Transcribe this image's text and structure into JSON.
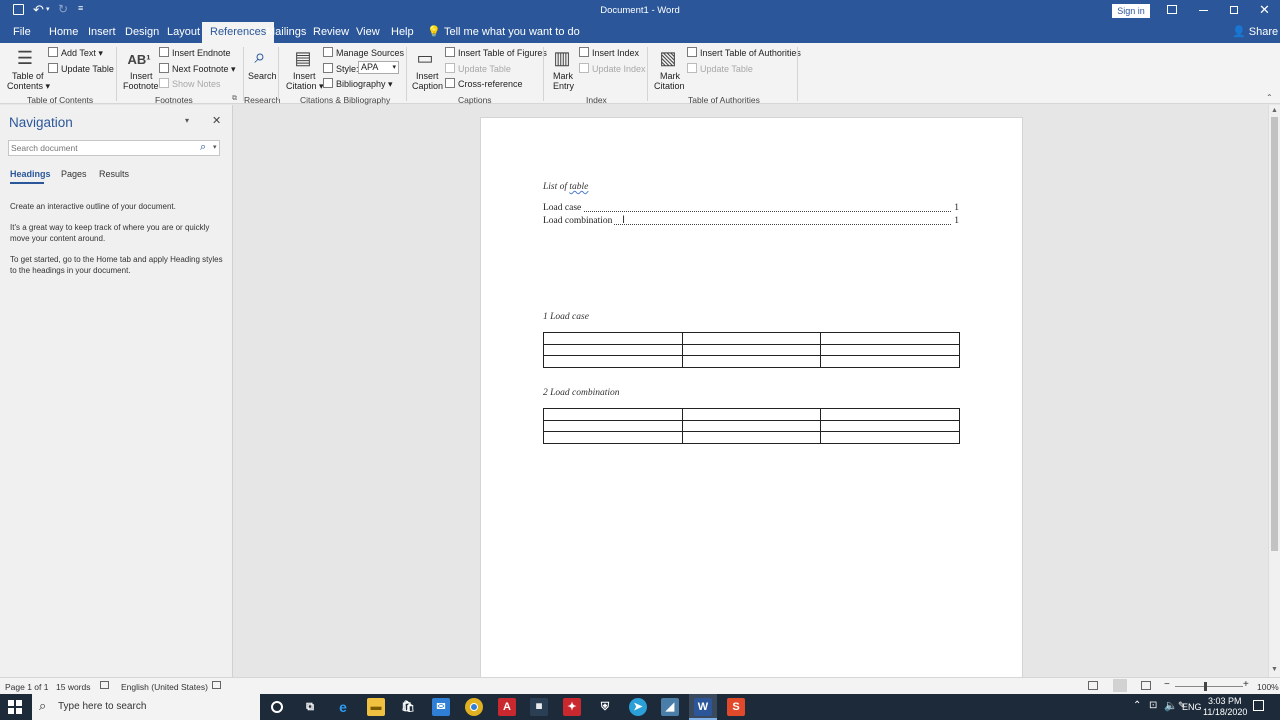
{
  "titlebar": {
    "title": "Document1  -  Word",
    "signin": "Sign in",
    "share": "Share"
  },
  "tabs": [
    "File",
    "Home",
    "Insert",
    "Design",
    "Layout",
    "References",
    "Mailings",
    "Review",
    "View",
    "Help"
  ],
  "tell_me": "Tell me what you want to do",
  "ribbon": {
    "toc": {
      "big": "Table of",
      "big2": "Contents",
      "add_text": "Add Text",
      "update_table": "Update Table",
      "group": "Table of Contents"
    },
    "footnotes": {
      "insert_footnote": "Insert",
      "insert_footnote2": "Footnote",
      "insert_endnote": "Insert Endnote",
      "next_footnote": "Next Footnote",
      "show_notes": "Show Notes",
      "group": "Footnotes"
    },
    "research": {
      "search": "Search",
      "group": "Research"
    },
    "citations": {
      "insert_citation": "Insert",
      "insert_citation2": "Citation",
      "manage_sources": "Manage Sources",
      "style_label": "Style:",
      "style_value": "APA",
      "bibliography": "Bibliography",
      "group": "Citations & Bibliography"
    },
    "captions": {
      "insert_caption": "Insert",
      "insert_caption2": "Caption",
      "insert_tof": "Insert Table of Figures",
      "update_table": "Update Table",
      "cross_ref": "Cross-reference",
      "group": "Captions"
    },
    "index": {
      "mark_entry": "Mark",
      "mark_entry2": "Entry",
      "insert_index": "Insert Index",
      "update_index": "Update Index",
      "group": "Index"
    },
    "toa": {
      "mark_citation": "Mark",
      "mark_citation2": "Citation",
      "insert_toa": "Insert Table of Authorities",
      "update_table": "Update Table",
      "group": "Table of Authorities"
    }
  },
  "navigation": {
    "title": "Navigation",
    "search_placeholder": "Search document",
    "tabs": [
      "Headings",
      "Pages",
      "Results"
    ],
    "p1": "Create an interactive outline of your document.",
    "p2a": "It's a great way to keep track of where you are or quickly",
    "p2b": "move your content around.",
    "p3a": "To get started, go to the Home tab and apply Heading styles",
    "p3b": "to the headings in your document."
  },
  "document": {
    "heading_a": "List of ",
    "heading_b": "table",
    "toc": [
      {
        "label": "Load case",
        "page": "1"
      },
      {
        "label": "Load combination",
        "page": "1"
      }
    ],
    "caption1": "1 Load case",
    "caption2": "2 Load combination"
  },
  "status": {
    "page": "Page 1 of 1",
    "words": "15 words",
    "language": "English (United States)",
    "zoom": "100%"
  },
  "taskbar": {
    "search": "Type here to search",
    "lang": "ENG",
    "time": "3:03 PM",
    "date": "11/18/2020"
  }
}
